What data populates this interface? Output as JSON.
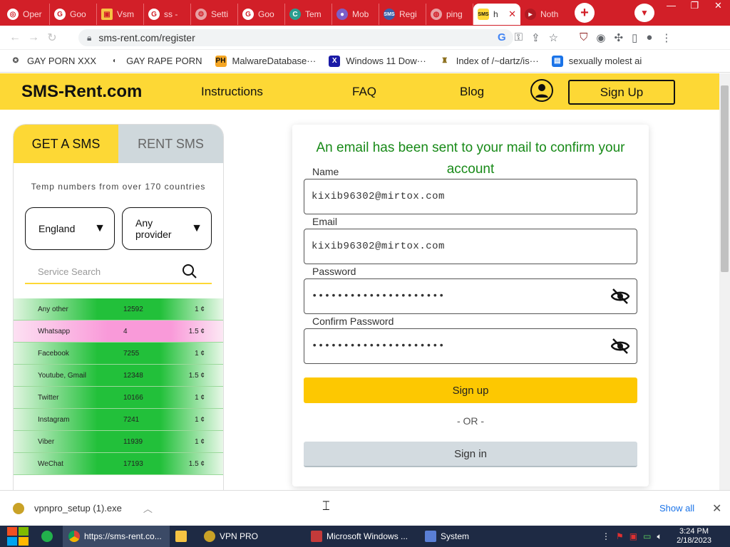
{
  "browser": {
    "tabs": [
      {
        "label": "Oper",
        "icon": "openai-icon"
      },
      {
        "label": "Goo",
        "icon": "google-icon"
      },
      {
        "label": "Vsm",
        "icon": "vsm-icon"
      },
      {
        "label": "ss -",
        "icon": "google-icon"
      },
      {
        "label": "Setti",
        "icon": "settings-icon"
      },
      {
        "label": "Goo",
        "icon": "google-icon"
      },
      {
        "label": "Tem",
        "icon": "temp-icon"
      },
      {
        "label": "Mob",
        "icon": "mob-icon"
      },
      {
        "label": "Regi",
        "icon": "sms-icon"
      },
      {
        "label": "ping",
        "icon": "globe-icon"
      },
      {
        "label": "h",
        "icon": "sms-rent-icon",
        "active": true
      },
      {
        "label": "Noth",
        "icon": "red-icon"
      }
    ],
    "new_tab": "+",
    "url": "sms-rent.com/register",
    "bookmarks": [
      {
        "label": "GAY PORN XXX",
        "icon": "bookmark-icon"
      },
      {
        "label": "GAY RAPE PORN",
        "icon": "globe-icon"
      },
      {
        "label": "MalwareDatabase···",
        "icon": "ph-icon"
      },
      {
        "label": "Windows 11 Dow···",
        "icon": "x-icon"
      },
      {
        "label": "Index of /~dartz/is···",
        "icon": "folder-icon"
      },
      {
        "label": "sexually molest ai",
        "icon": "doc-icon"
      }
    ]
  },
  "site": {
    "logo": "SMS-Rent.com",
    "nav": [
      "Instructions",
      "FAQ",
      "Blog"
    ],
    "signup_button": "Sign Up",
    "panel": {
      "tabs": [
        "GET A SMS",
        "RENT SMS"
      ],
      "description": "Temp numbers from over 170 countries",
      "country": "England",
      "provider": "Any provider",
      "search_placeholder": "Service Search",
      "services": [
        {
          "name": "Any other",
          "count": "12592",
          "price": "1 ¢",
          "highlight": false
        },
        {
          "name": "Whatsapp",
          "count": "4",
          "price": "1.5 ¢",
          "highlight": true
        },
        {
          "name": "Facebook",
          "count": "7255",
          "price": "1 ¢",
          "highlight": false
        },
        {
          "name": "Youtube, Gmail",
          "count": "12348",
          "price": "1.5 ¢",
          "highlight": false
        },
        {
          "name": "Twitter",
          "count": "10166",
          "price": "1 ¢",
          "highlight": false
        },
        {
          "name": "Instagram",
          "count": "7241",
          "price": "1 ¢",
          "highlight": false
        },
        {
          "name": "Viber",
          "count": "11939",
          "price": "1 ¢",
          "highlight": false
        },
        {
          "name": "WeChat",
          "count": "17193",
          "price": "1.5 ¢",
          "highlight": false
        }
      ]
    },
    "form": {
      "message": "An email has been sent to your mail to confirm your account",
      "name_label": "Name",
      "name_value": "kixib96302@mirtox.com",
      "email_label": "Email",
      "email_value": "kixib96302@mirtox.com",
      "password_label": "Password",
      "password_value": "•••••••••••••••••••••",
      "confirm_label": "Confirm Password",
      "confirm_value": "•••••••••••••••••••••",
      "submit": "Sign up",
      "or": "- OR -",
      "signin": "Sign in"
    }
  },
  "downloads": {
    "file": "vpnpro_setup (1).exe",
    "show_all": "Show all"
  },
  "taskbar": {
    "items": [
      {
        "label": "https://sms-rent.co...",
        "icon": "chrome-icon"
      },
      {
        "label": "",
        "icon": "folder-icon"
      },
      {
        "label": "VPN PRO",
        "icon": "vpn-icon"
      },
      {
        "label": "Microsoft Windows ...",
        "icon": "windows-app-icon"
      },
      {
        "label": "System",
        "icon": "system-icon"
      }
    ],
    "time": "3:24 PM",
    "date": "2/18/2023"
  },
  "colors": {
    "tabbar": "#d21f28",
    "brand_yellow": "#fdd835",
    "signup_yellow": "#fdc801",
    "success_green": "#188a18"
  }
}
